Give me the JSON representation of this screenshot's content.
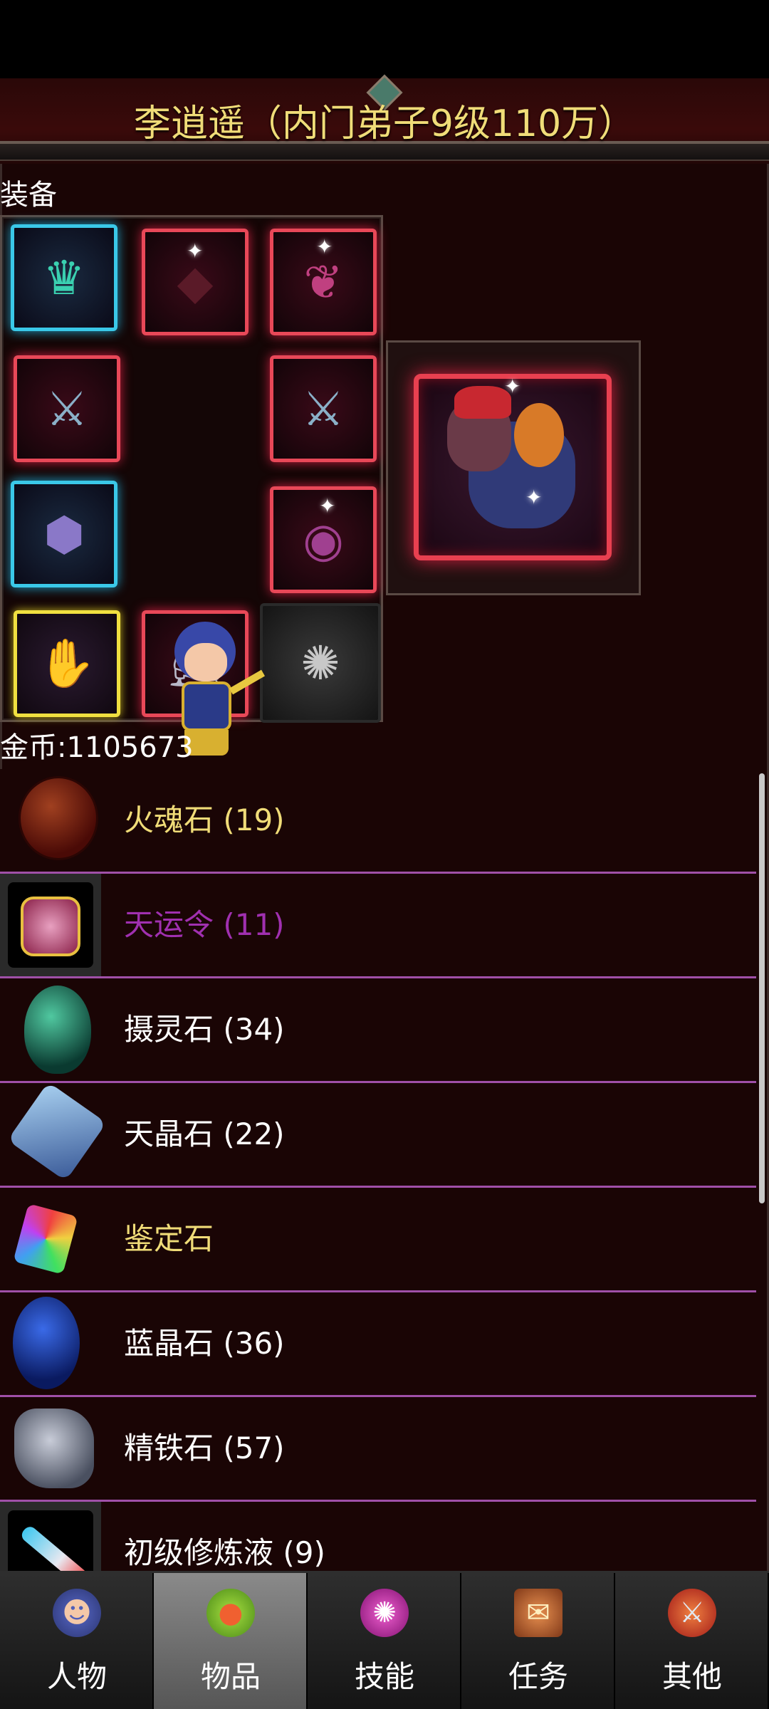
{
  "header": {
    "title": "李逍遥（内门弟子9级110万）"
  },
  "equipment": {
    "section_label": "装备",
    "slots": [
      {
        "name": "helmet",
        "rarity_color": "#3ac8e8",
        "icon": "crown-icon"
      },
      {
        "name": "armor",
        "rarity_color": "#e84858",
        "icon": "armor-icon"
      },
      {
        "name": "necklace",
        "rarity_color": "#e84858",
        "icon": "necklace-icon"
      },
      {
        "name": "weapon-left",
        "rarity_color": "#e84858",
        "icon": "sword-icon"
      },
      {
        "name": "weapon-right",
        "rarity_color": "#e84858",
        "icon": "sword-icon"
      },
      {
        "name": "bracer",
        "rarity_color": "#3ac8e8",
        "icon": "bracer-icon"
      },
      {
        "name": "ring",
        "rarity_color": "#e84858",
        "icon": "ring-icon"
      },
      {
        "name": "gloves",
        "rarity_color": "#f0e040",
        "icon": "glove-icon"
      },
      {
        "name": "boots",
        "rarity_color": "#e84858",
        "icon": "boots-icon"
      },
      {
        "name": "accessory",
        "rarity_color": "#2a2a2a",
        "icon": "gear-icon"
      }
    ],
    "mount": {
      "icon": "demon-mount-icon",
      "rarity_color": "#e84050"
    }
  },
  "gold": {
    "label": "金币:1105673"
  },
  "items": [
    {
      "name": "火魂石 (19)",
      "color": "#f0dc78",
      "icon": "fire-soul-stone-icon"
    },
    {
      "name": "天运令 (11)",
      "color": "#a030b0",
      "icon": "fortune-token-icon"
    },
    {
      "name": "摄灵石 (34)",
      "color": "#ffffff",
      "icon": "spirit-stone-icon"
    },
    {
      "name": "天晶石 (22)",
      "color": "#ffffff",
      "icon": "sky-crystal-icon"
    },
    {
      "name": "鉴定石",
      "color": "#f0dc78",
      "icon": "identify-stone-icon"
    },
    {
      "name": "蓝晶石 (36)",
      "color": "#ffffff",
      "icon": "blue-crystal-icon"
    },
    {
      "name": "精铁石 (57)",
      "color": "#ffffff",
      "icon": "iron-ore-icon"
    },
    {
      "name": "初级修炼液 (9)",
      "color": "#ffffff",
      "icon": "potion-vial-icon"
    }
  ],
  "nav": {
    "tabs": [
      {
        "label": "人物",
        "icon": "character-icon",
        "active": false
      },
      {
        "label": "物品",
        "icon": "potion-bag-icon",
        "active": true
      },
      {
        "label": "技能",
        "icon": "skill-swirl-icon",
        "active": false
      },
      {
        "label": "任务",
        "icon": "quest-scroll-icon",
        "active": false
      },
      {
        "label": "其他",
        "icon": "sword-shield-icon",
        "active": false
      }
    ]
  }
}
